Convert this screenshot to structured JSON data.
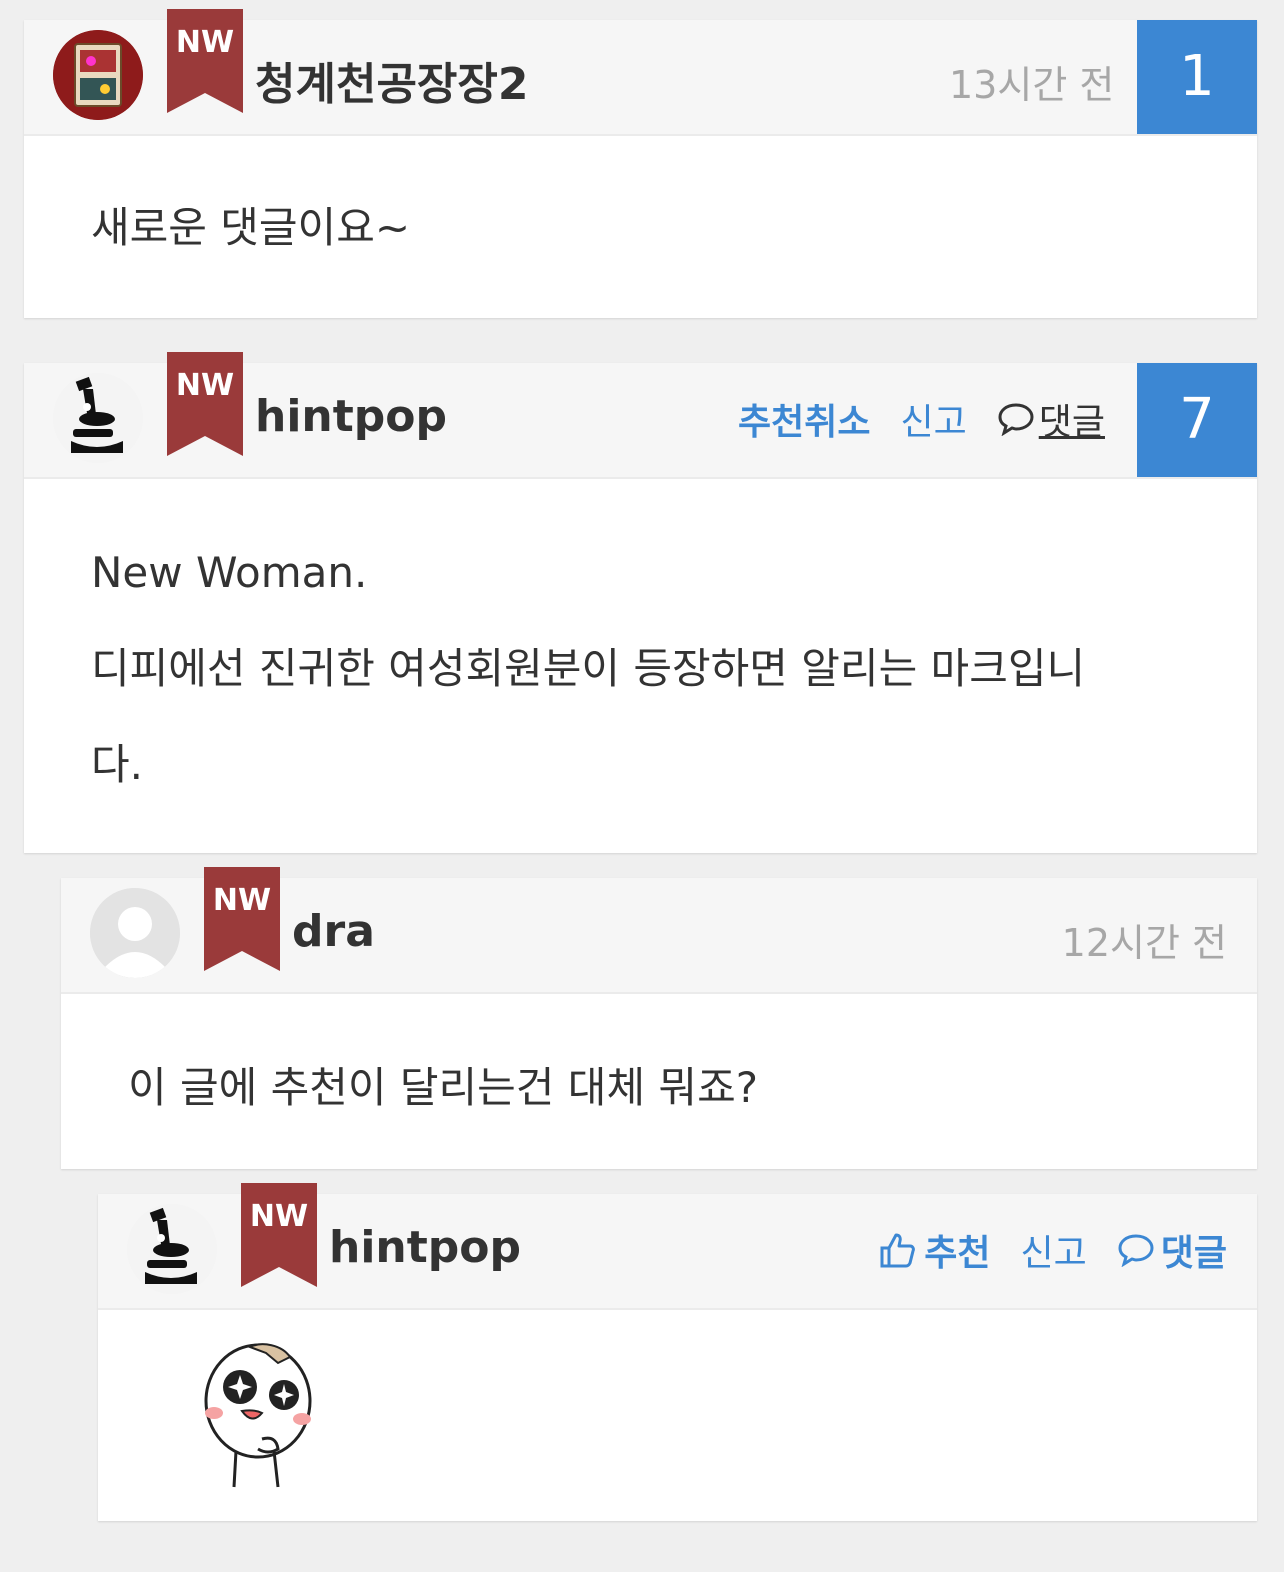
{
  "comments": [
    {
      "badge": "NW",
      "author": "청계천공장장2",
      "time": "13시간 전",
      "count": "1",
      "text": "새로운 댓글이요~"
    },
    {
      "badge": "NW",
      "author": "hintpop",
      "actions": {
        "recommend_cancel": "추천취소",
        "report": "신고",
        "reply": "댓글"
      },
      "count": "7",
      "text_line1": "New Woman.",
      "text_line2": "디피에선 진귀한 여성회원분이 등장하면 알리는 마크입니",
      "text_line3": "다."
    },
    {
      "badge": "NW",
      "author": "dra",
      "time": "12시간 전",
      "text": "이 글에 추천이 달리는건 대체 뭐죠?"
    },
    {
      "badge": "NW",
      "author": "hintpop",
      "actions": {
        "recommend": "추천",
        "report": "신고",
        "reply": "댓글"
      }
    }
  ],
  "colors": {
    "accent": "#3c87d3",
    "badge": "#9a3a3a",
    "background": "#efefef"
  }
}
